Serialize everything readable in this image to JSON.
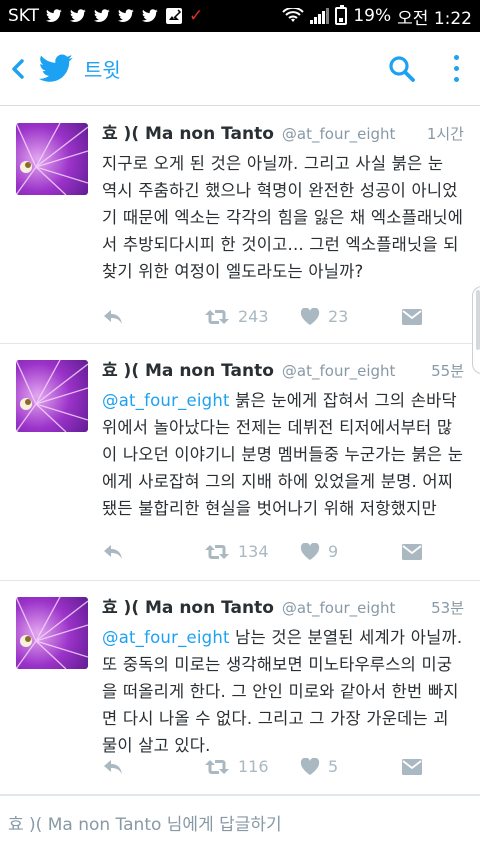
{
  "statusbar": {
    "carrier": "SKT",
    "battery": "19%",
    "time": "오전 1:22",
    "colors": {
      "background": "#000000",
      "text": "#ffffff",
      "alert": "#e0302a"
    }
  },
  "appbar": {
    "title": "트윗",
    "accent": "#1da1f2"
  },
  "tweets": [
    {
      "name": "효 )( Ma non Tanto",
      "handle": "@at_four_eight",
      "time": "1시간",
      "mention": "",
      "text": "지구로 오게 된 것은 아닐까. 그리고 사실 붉은 눈 역시 주춤하긴 했으나 혁명이 완전한 성공이 아니었기 때문에 엑소는 각각의 힘을 잃은 채 엑소플래닛에서 추방되다시피 한 것이고... 그런 엑소플래닛을 되찾기 위한 여정이 엘도라도는 아닐까?",
      "retweets": "243",
      "likes": "23"
    },
    {
      "name": "효 )( Ma non Tanto",
      "handle": "@at_four_eight",
      "time": "55분",
      "mention": "@at_four_eight",
      "text": " 붉은 눈에게 잡혀서 그의 손바닥 위에서 놀아났다는 전제는 데뷔전 티저에서부터 많이 나오던 이야기니 분명 멤버들중 누군가는 붉은 눈에게 사로잡혀 그의 지배 하에 있었을게 분명. 어찌됐든 불합리한 현실을 벗어나기 위해 저항했지만",
      "retweets": "134",
      "likes": "9"
    },
    {
      "name": "효 )( Ma non Tanto",
      "handle": "@at_four_eight",
      "time": "53분",
      "mention": "@at_four_eight",
      "text": " 남는 것은 분열된 세계가 아닐까. 또 중독의 미로는 생각해보면 미노타우루스의 미궁을 떠올리게 한다. 그 안인 미로와 같아서 한번 빠지면 다시 나올 수 없다. 그리고 그 가장 가운데는 괴물이 살고 있다.",
      "retweets": "116",
      "likes": "5"
    }
  ],
  "reply": {
    "placeholder": "효 )( Ma non Tanto 님에게 답글하기"
  },
  "icons": {
    "back": "chevron-left-icon",
    "logo": "twitter-bird-icon",
    "search": "search-icon",
    "more": "more-vertical-icon",
    "reply": "reply-icon",
    "retweet": "retweet-icon",
    "like": "heart-icon",
    "dm": "envelope-icon"
  }
}
